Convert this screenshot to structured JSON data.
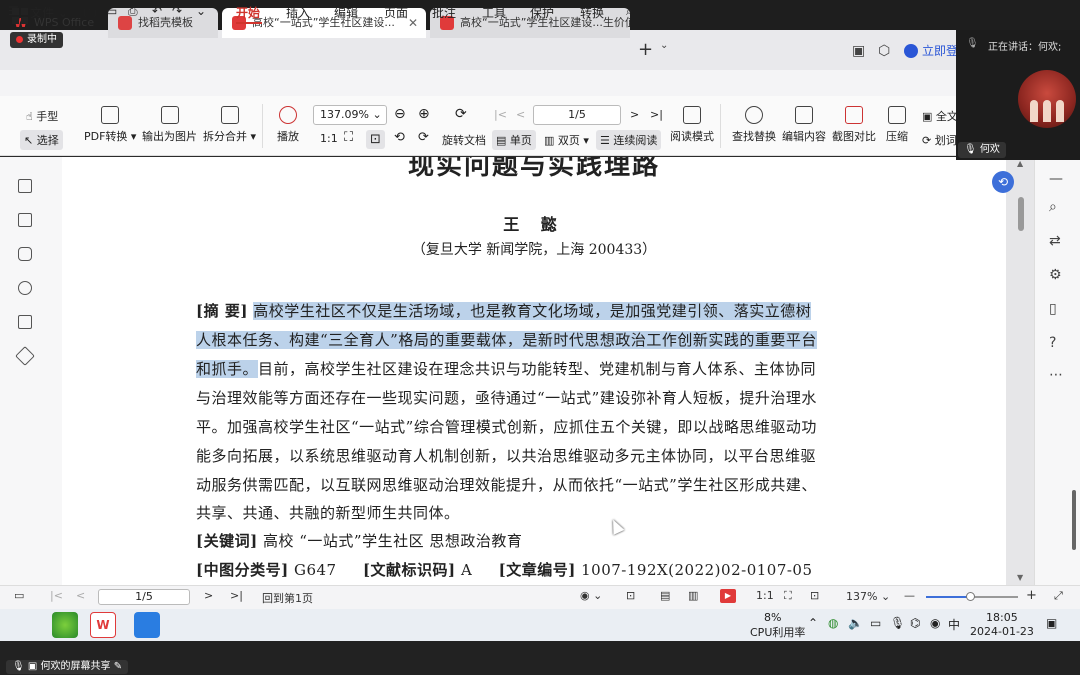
{
  "recording": {
    "label": "录制中"
  },
  "tabs": [
    {
      "label": "WPS Office"
    },
    {
      "label": "找稻壳模板"
    },
    {
      "label": "高校“一站式”学生社区建设..."
    },
    {
      "label": "高校“一站式”学生社区建设...生价值"
    }
  ],
  "tab_add": "+",
  "login_label": "立即登录",
  "menu": {
    "file": "文件",
    "items": [
      "开始",
      "插入",
      "编辑",
      "页面",
      "批注",
      "工具",
      "保护",
      "转换"
    ]
  },
  "ribbon": {
    "hand": "手型",
    "select": "选择",
    "pdf_convert": "PDF转换",
    "export_image": "输出为图片",
    "split_merge": "拆分合并",
    "play": "播放",
    "zoom": "137.09%",
    "page": "1/5",
    "rotate": "旋转文档",
    "single": "单页",
    "double": "双页",
    "continuous": "连续阅读",
    "read_mode": "阅读模式",
    "find_replace": "查找替换",
    "edit_content": "编辑内容",
    "screenshot_compare": "截图对比",
    "compress": "压缩",
    "full_text": "全文",
    "underline": "划词"
  },
  "document": {
    "title": "现实问题与实践理路",
    "author": "王 懿",
    "affiliation": "（复旦大学 新闻学院，上海 200433）",
    "abstract_label": "[摘 要]",
    "lines": [
      {
        "hl": "高校学生社区不仅是生活场域，也是教育文化场域，是加强党建引领、落实立德树",
        "rest": ""
      },
      {
        "hl": "人根本任务、构建“三全育人”格局的重要载体，是新时代思想政治工作创新实践的重要平台",
        "rest": ""
      },
      {
        "hl": "和抓手。",
        "rest": "目前，高校学生社区建设在理念共识与功能转型、党建机制与育人体系、主体协同"
      },
      {
        "hl": "",
        "rest": "与治理效能等方面还存在一些现实问题，亟待通过“一站式”建设弥补育人短板，提升治理水"
      },
      {
        "hl": "",
        "rest": "平。加强高校学生社区“一站式”综合管理模式创新，应抓住五个关键，即以战略思维驱动功"
      },
      {
        "hl": "",
        "rest": "能多向拓展，以系统思维驱动育人机制创新，以共治思维驱动多元主体协同，以平台思维驱"
      },
      {
        "hl": "",
        "rest": "动服务供需匹配，以互联网思维驱动治理效能提升，从而依托“一站式”学生社区形成共建、"
      },
      {
        "hl": "",
        "rest": "共享、共通、共融的新型师生共同体。"
      }
    ],
    "keywords_label": "[关键词]",
    "keywords": "高校 “一站式”学生社区 思想政治教育",
    "clc_label": "[中图分类号]",
    "clc": "G647",
    "doc_code_label": "[文献标识码]",
    "doc_code": "A",
    "article_no_label": "[文章编号]",
    "article_no": "1007-192X(2022)02-0107-05"
  },
  "status": {
    "page": "1/5",
    "back_first": "回到第1页",
    "zoom": "137%"
  },
  "taskbar": {
    "cpu_pct": "8%",
    "cpu_label": "CPU利用率",
    "ime": "中",
    "time": "18:05",
    "date": "2024-01-23"
  },
  "meeting": {
    "speaking": "正在讲话：何欢;",
    "speaker": "何欢",
    "share_label": "何欢的屏幕共享"
  }
}
